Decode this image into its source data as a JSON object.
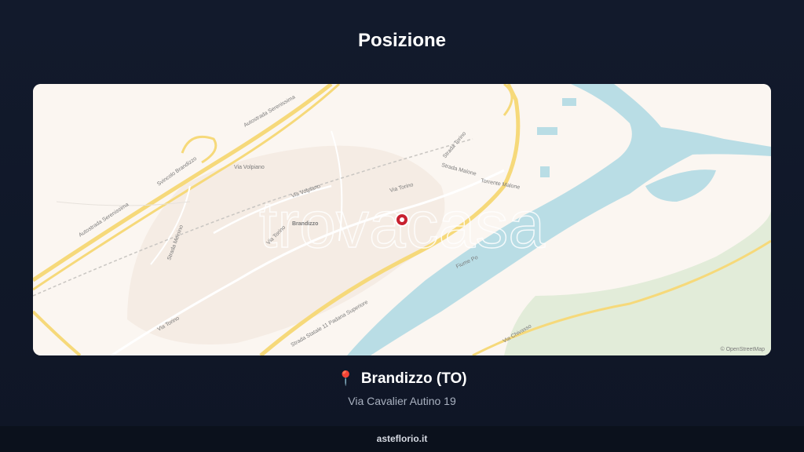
{
  "page": {
    "title": "Posizione"
  },
  "map": {
    "watermark": "trovacasa",
    "attribution": "© OpenStreetMap",
    "labels": {
      "town": "Brandizzo",
      "autostrada_1": "Autostrada Serenissima",
      "autostrada_2": "Autostrada Serenissima",
      "svincolo": "Svincolo Brandizzo",
      "via_volpiano": "Via Volpiano",
      "via_torino_1": "Via Torino",
      "via_torino_2": "Via Torino",
      "via_torino_3": "Via Torino",
      "via_volpiano_2": "Via Volpiano",
      "strada_statale": "Strada Statale 11 Padana Superiore",
      "strada_torino": "Strada Torino",
      "fiume_po": "Fiume Po",
      "strada_malone": "Strada Malone",
      "torrente_malone": "Torrente Malone",
      "strada_meinino": "Strada Meinino",
      "via_chivasso": "Via Chivasso"
    },
    "marker_icon": "map-marker-icon"
  },
  "location": {
    "icon": "pin-icon",
    "icon_glyph": "📍",
    "city": "Brandizzo (TO)",
    "address": "Via Cavalier Autino 19"
  },
  "footer": {
    "site": "asteflorio.it"
  },
  "colors": {
    "background": "#121a2c",
    "map_land": "#fbf6f1",
    "water": "#b9dde5",
    "road_major": "#f6d97a",
    "marker": "#c8202f"
  }
}
